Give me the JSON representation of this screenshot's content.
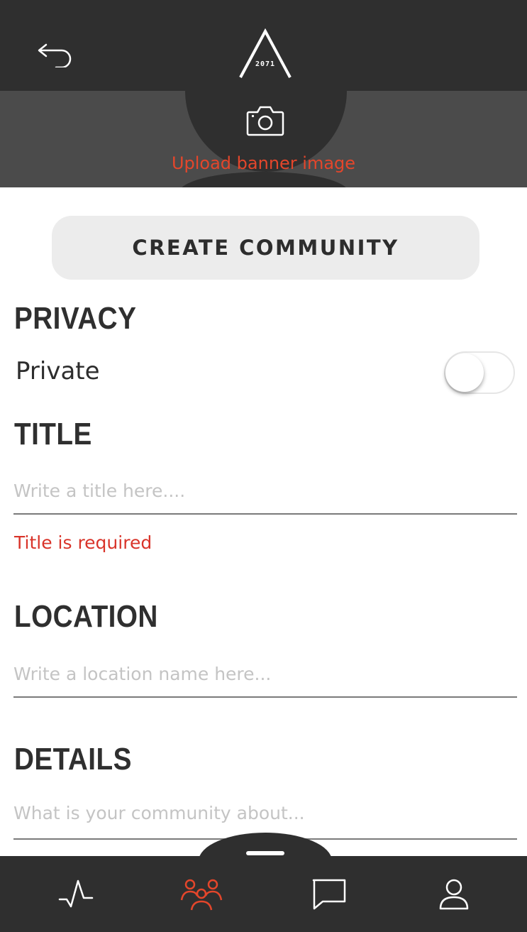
{
  "header": {
    "logo_text": "2071"
  },
  "banner": {
    "upload_label": "Upload banner image",
    "icon": "camera-icon"
  },
  "main": {
    "create_button_label": "CREATE COMMUNITY",
    "privacy": {
      "title": "PRIVACY",
      "toggle_label": "Private",
      "toggle_on": false
    },
    "title_section": {
      "title": "TITLE",
      "placeholder": "Write a title here....",
      "value": "",
      "error": "Title is required"
    },
    "location_section": {
      "title": "LOCATION",
      "placeholder": "Write a location name here...",
      "value": ""
    },
    "details_section": {
      "title": "DETAILS",
      "placeholder": "What is your community about...",
      "value": ""
    }
  },
  "nav": {
    "items": [
      {
        "icon": "activity-icon",
        "active": false
      },
      {
        "icon": "community-icon",
        "active": true
      },
      {
        "icon": "chat-icon",
        "active": false
      },
      {
        "icon": "profile-icon",
        "active": false
      }
    ]
  },
  "colors": {
    "accent": "#e4462b",
    "error": "#d9342a",
    "dark_bar": "#2f2f2f",
    "banner_bg": "#4b4b4b"
  }
}
